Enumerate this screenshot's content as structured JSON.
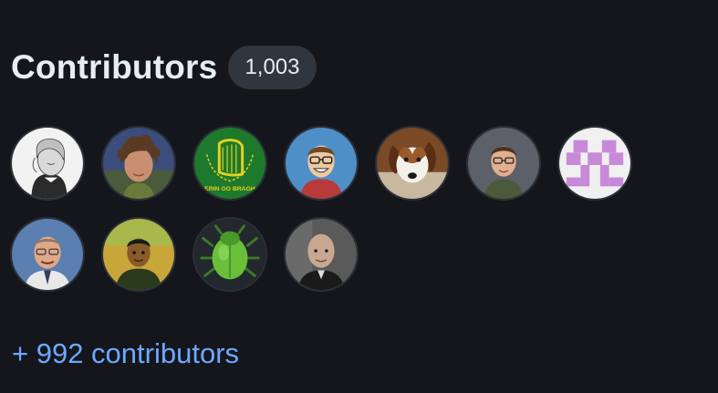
{
  "contributors": {
    "title": "Contributors",
    "count": "1,003",
    "more_link": "+ 992 contributors",
    "avatars": [
      {
        "name": "contributor-avatar-1",
        "icon": "portrait-engraving",
        "bg": "#f2f2f2"
      },
      {
        "name": "contributor-avatar-2",
        "icon": "curly-hair-man-photo",
        "bg": "#3b4d7a"
      },
      {
        "name": "contributor-avatar-3",
        "icon": "harp-flag-erin-go-bragh",
        "bg": "#1d7a2c",
        "logo_text": "ERIN GO BRAGH"
      },
      {
        "name": "contributor-avatar-4",
        "icon": "cartoon-man-glasses",
        "bg": "#4f8fc8"
      },
      {
        "name": "contributor-avatar-5",
        "icon": "dog-photo",
        "bg": "#7a4a26"
      },
      {
        "name": "contributor-avatar-6",
        "icon": "man-glasses-photo",
        "bg": "#5c6068"
      },
      {
        "name": "contributor-avatar-7",
        "icon": "identicon-pink",
        "bg": "#f0f0f0",
        "accent": "#c88ad8"
      },
      {
        "name": "contributor-avatar-8",
        "icon": "man-blue-background-photo",
        "bg": "#5a7fb0"
      },
      {
        "name": "contributor-avatar-9",
        "icon": "man-outdoors-photo",
        "bg": "#c8a63a"
      },
      {
        "name": "contributor-avatar-10",
        "icon": "green-bug-logo",
        "bg": "#23282e",
        "accent": "#6abf3a"
      },
      {
        "name": "contributor-avatar-11",
        "icon": "bald-man-photo",
        "bg": "#5a5a5a"
      }
    ]
  }
}
